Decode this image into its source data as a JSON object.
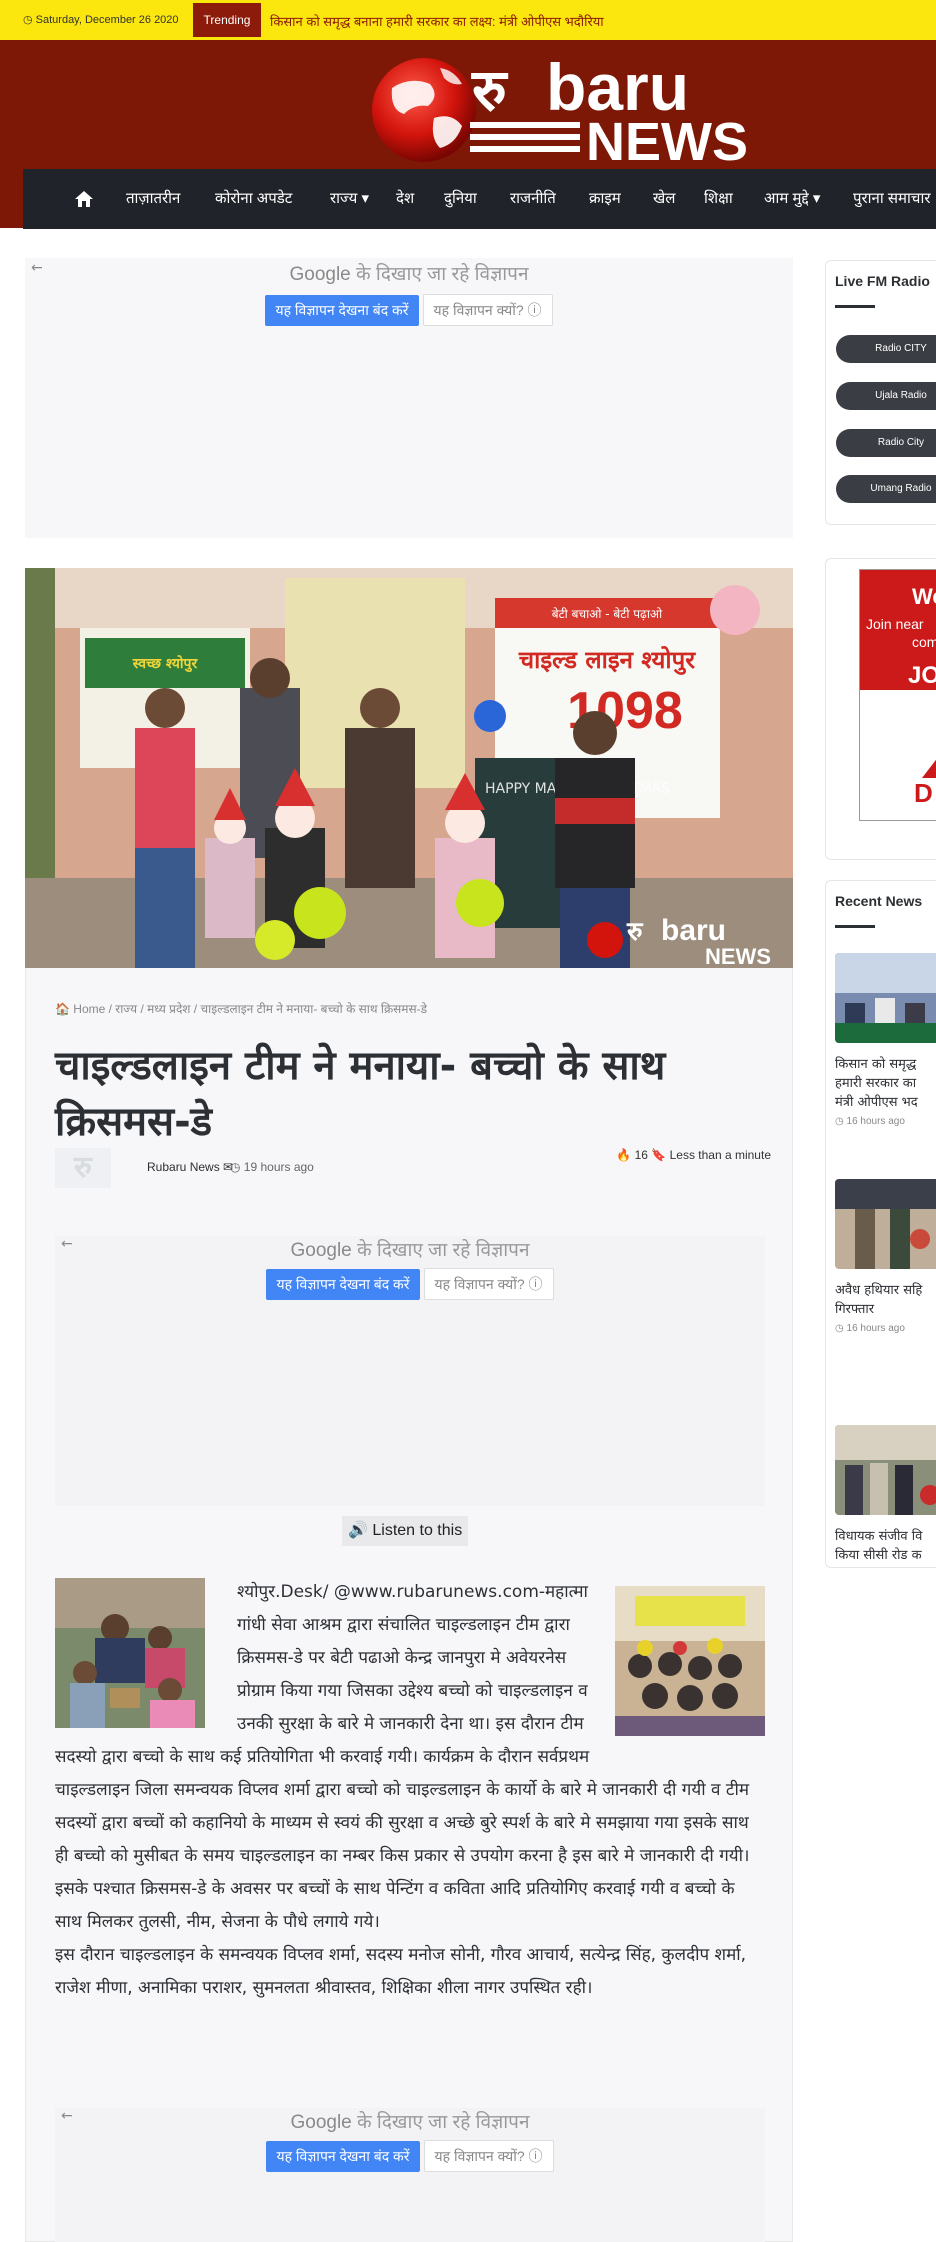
{
  "topbar": {
    "date": "Saturday, December 26 2020",
    "trending_label": "Trending",
    "ticker": "किसान को समृद्ध बनाना हमारी सरकार का लक्ष्य: मंत्री ओपीएस भदौरिया"
  },
  "logo": {
    "ru": "रु",
    "barru": "baru",
    "news": "NEWS"
  },
  "nav": {
    "items": [
      "ताज़ातरीन",
      "कोरोना अपडेट",
      "राज्य ▾",
      "देश",
      "दुनिया",
      "राजनीति",
      "क्राइम",
      "खेल",
      "शिक्षा",
      "आम मुद्दे ▾",
      "पुराना समाचार"
    ]
  },
  "ad": {
    "google": "Google",
    "title_suffix": " के दिखाए जा रहे विज्ञापन",
    "stop_button": "यह विज्ञापन देखना बंद करें",
    "why_button": "यह विज्ञापन क्यों? ⓘ",
    "back_arrow": "←"
  },
  "photo": {
    "banner_text": "चाइल्ड लाइन श्योपुर",
    "banner_number": "1098",
    "banner_top": "बेटी बचाओ - बेटी पढ़ाओ",
    "board_text": "HAPPY MARRY CHRISTMAS",
    "watermark_ru": "रु",
    "watermark_baru": "baru",
    "watermark_news": "NEWS",
    "wall_text": "स्वच्छ श्योपुर"
  },
  "article": {
    "breadcrumb": "🏠 Home / राज्य / मध्य प्रदेश / चाइल्डलाइन टीम ने मनाया- बच्चो के साथ क्रिसमस-डे",
    "title": "चाइल्डलाइन टीम ने मनाया- बच्चो के साथ क्रिसमस-डे",
    "avatar_text": "रु",
    "author": "Rubaru News ✉",
    "time_ago": "◷ 19 hours ago",
    "views": "🔥 16   🔖 Less than a minute",
    "listen": "🔊 Listen to this",
    "paragraph1": "श्योपुर.Desk/ @www.rubarunews.com-महात्मा गांधी सेवा आश्रम द्वारा संचालित चाइल्डलाइन टीम द्वारा क्रिसमस-डे पर बेटी पढाओ केन्द्र जानपुरा मे अवेयरनेस प्रोग्राम किया गया जिसका उद्देश्य बच्चो को चाइल्डलाइन व उनकी सुरक्षा के बारे मे जानकारी देना था। इस दौरान टीम सदस्यो द्वारा बच्चो के साथ कई प्रतियोगिता भी करवाई गयी। कार्यक्रम के दौरान सर्वप्रथम चाइल्डलाइन जिला समन्वयक विप्लव शर्मा द्वारा बच्चो को चाइल्डलाइन के कार्यो के बारे मे जानकारी दी गयी व टीम सदस्यों द्वारा बच्चों को कहानियो के माध्यम से स्वयं की सुरक्षा व अच्छे बुरे स्पर्श के बारे मे समझाया गया इसके साथ ही बच्चो को मुसीबत के समय चाइल्डलाइन का नम्बर किस प्रकार से उपयोग करना है इस बारे मे जानकारी दी गयी।",
    "paragraph2": "इसके पश्चात क्रिसमस-डे के अवसर पर बच्चों के साथ पेन्टिंग व कविता आदि प्रतियोगिए करवाई गयी व बच्चो के साथ मिलकर तुलसी, नीम, सेजना के पौधे लगाये गये।",
    "paragraph3": "इस दौरान चाइल्डलाइन के समन्वयक विप्लव शर्मा, सदस्य मनोज सोनी, गौरव आचार्य, सत्येन्द्र सिंह, कुलदीप शर्मा, राजेश मीणा, अनामिका पराशर, सुमनलता श्रीवास्तव, शिक्षिका शीला नागर उपस्थित रही।"
  },
  "sidebar": {
    "radio": {
      "title": "Live FM Radio",
      "stations": [
        "Radio CITY",
        "Ujala Radio",
        "Radio City",
        "Umang Radio"
      ]
    },
    "side_ad": {
      "we": "We",
      "line1": "Join near",
      "line2": "com",
      "line3": "a",
      "join": "JOI",
      "d": "D"
    },
    "recent": {
      "title": "Recent News",
      "items": [
        {
          "line1": "किसान को समृद्ध",
          "line2": "हमारी सरकार का",
          "line3": "मंत्री ओपीएस भद",
          "time": "◷ 16 hours ago"
        },
        {
          "line1": "अवैध हथियार सहि",
          "line2": "गिरफ्तार",
          "line3": "",
          "time": "◷ 16 hours ago"
        },
        {
          "line1": "विधायक संजीव वि",
          "line2": "किया सीसी रोड क",
          "line3": "",
          "time": ""
        }
      ]
    }
  },
  "colors": {
    "topbar": "#fbe70d",
    "header": "#7d1807",
    "trending": "#8d1b0b",
    "navbar": "#20232a",
    "ad_button": "#4285f4"
  }
}
